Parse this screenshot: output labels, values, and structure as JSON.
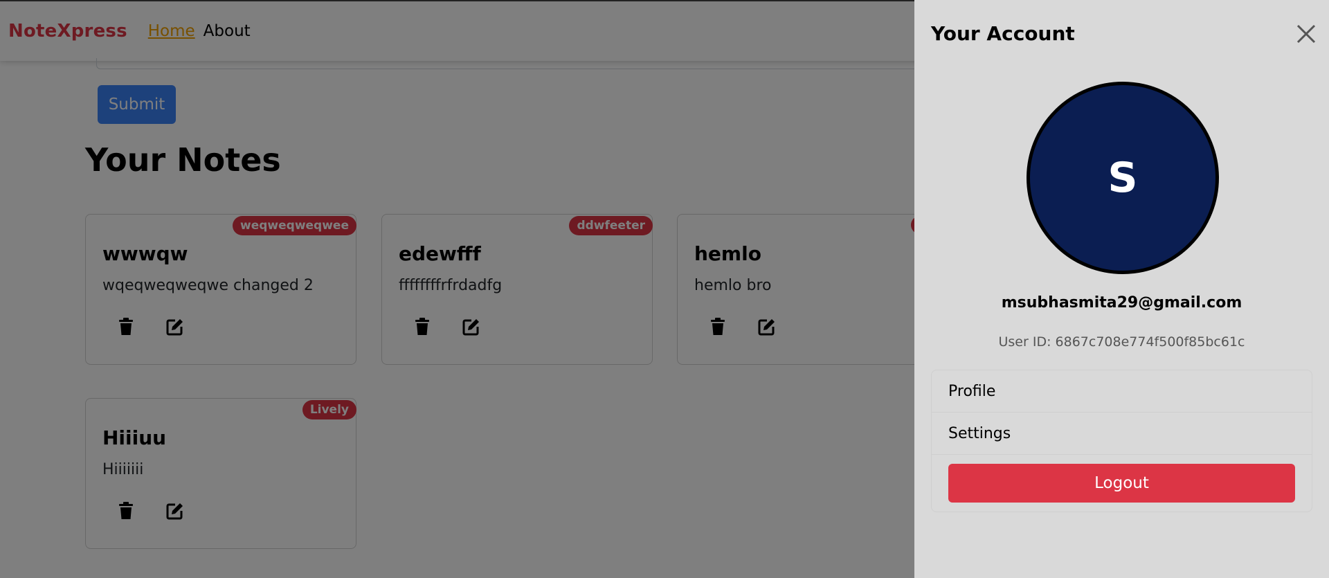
{
  "navbar": {
    "brand": "NoteXpress",
    "links": [
      {
        "label": "Home",
        "active": true
      },
      {
        "label": "About",
        "active": false
      }
    ]
  },
  "form": {
    "submit_label": "Submit"
  },
  "notes_section": {
    "title": "Your Notes",
    "notes": [
      {
        "title": "wwwqw",
        "description": "wqeqweqweqwe changed 2",
        "tag": "weqweqweqwee"
      },
      {
        "title": "edewfff",
        "description": "ffffffffrfrdadfg",
        "tag": "ddwfeeter"
      },
      {
        "title": "hemlo",
        "description": "hemlo bro",
        "tag": ""
      },
      {
        "title": "Hiiiuu",
        "description": "Hiiiiiii",
        "tag": "Lively"
      }
    ],
    "action_icons": [
      "trash-icon",
      "edit-icon"
    ]
  },
  "account_panel": {
    "title": "Your Account",
    "close_icon": "close-icon",
    "avatar_initial": "S",
    "email": "msubhasmita29@gmail.com",
    "user_id": "User ID: 6867c708e774f500f85bc61c",
    "menu": [
      {
        "label": "Profile"
      },
      {
        "label": "Settings"
      }
    ],
    "logout_label": "Logout"
  },
  "colors": {
    "brand": "#dc3545",
    "active_link": "#f0a000",
    "primary": "#3b82f6",
    "danger": "#dc3545",
    "avatar_bg": "#0b1e52",
    "panel_bg": "#d9d9d9"
  }
}
